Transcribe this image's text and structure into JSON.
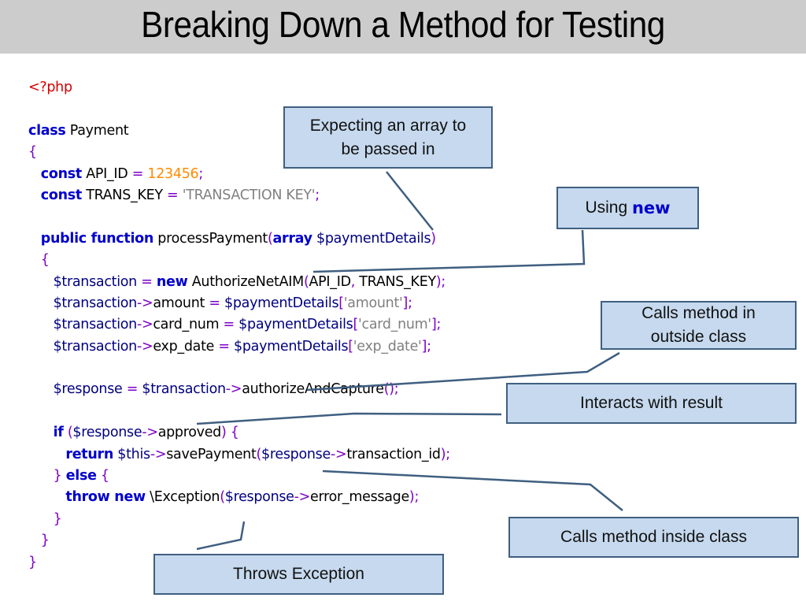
{
  "slide": {
    "title": "Breaking Down a Method for Testing"
  },
  "code": {
    "lines": [
      [
        {
          "t": "tag",
          "v": "<?php"
        }
      ],
      [],
      [
        {
          "t": "kw",
          "v": "class"
        },
        {
          "t": "ident",
          "v": " Payment"
        }
      ],
      [
        {
          "t": "op",
          "v": "{"
        }
      ],
      [
        {
          "t": "ident",
          "v": "   "
        },
        {
          "t": "kw",
          "v": "const"
        },
        {
          "t": "ident",
          "v": " API_ID "
        },
        {
          "t": "op",
          "v": "="
        },
        {
          "t": "ident",
          "v": " "
        },
        {
          "t": "num",
          "v": "123456"
        },
        {
          "t": "op",
          "v": ";"
        }
      ],
      [
        {
          "t": "ident",
          "v": "   "
        },
        {
          "t": "kw",
          "v": "const"
        },
        {
          "t": "ident",
          "v": " TRANS_KEY "
        },
        {
          "t": "op",
          "v": "="
        },
        {
          "t": "ident",
          "v": " "
        },
        {
          "t": "str",
          "v": "'TRANSACTION KEY'"
        },
        {
          "t": "op",
          "v": ";"
        }
      ],
      [],
      [
        {
          "t": "ident",
          "v": "   "
        },
        {
          "t": "kw",
          "v": "public function"
        },
        {
          "t": "ident",
          "v": " processPayment"
        },
        {
          "t": "op",
          "v": "("
        },
        {
          "t": "kw",
          "v": "array"
        },
        {
          "t": "var",
          "v": " $paymentDetails"
        },
        {
          "t": "op",
          "v": ")"
        }
      ],
      [
        {
          "t": "ident",
          "v": "   "
        },
        {
          "t": "op",
          "v": "{"
        }
      ],
      [
        {
          "t": "ident",
          "v": "      "
        },
        {
          "t": "var",
          "v": "$transaction"
        },
        {
          "t": "ident",
          "v": " "
        },
        {
          "t": "op",
          "v": "="
        },
        {
          "t": "ident",
          "v": " "
        },
        {
          "t": "kw",
          "v": "new"
        },
        {
          "t": "ident",
          "v": " AuthorizeNetAIM"
        },
        {
          "t": "op",
          "v": "("
        },
        {
          "t": "ident",
          "v": "API_ID"
        },
        {
          "t": "op",
          "v": ","
        },
        {
          "t": "ident",
          "v": " TRANS_KEY"
        },
        {
          "t": "op",
          "v": ");"
        }
      ],
      [
        {
          "t": "ident",
          "v": "      "
        },
        {
          "t": "var",
          "v": "$transaction"
        },
        {
          "t": "op",
          "v": "->"
        },
        {
          "t": "ident",
          "v": "amount "
        },
        {
          "t": "op",
          "v": "="
        },
        {
          "t": "var",
          "v": " $paymentDetails"
        },
        {
          "t": "op",
          "v": "["
        },
        {
          "t": "str",
          "v": "'amount'"
        },
        {
          "t": "op",
          "v": "];"
        }
      ],
      [
        {
          "t": "ident",
          "v": "      "
        },
        {
          "t": "var",
          "v": "$transaction"
        },
        {
          "t": "op",
          "v": "->"
        },
        {
          "t": "ident",
          "v": "card_num "
        },
        {
          "t": "op",
          "v": "="
        },
        {
          "t": "var",
          "v": " $paymentDetails"
        },
        {
          "t": "op",
          "v": "["
        },
        {
          "t": "str",
          "v": "'card_num'"
        },
        {
          "t": "op",
          "v": "];"
        }
      ],
      [
        {
          "t": "ident",
          "v": "      "
        },
        {
          "t": "var",
          "v": "$transaction"
        },
        {
          "t": "op",
          "v": "->"
        },
        {
          "t": "ident",
          "v": "exp_date "
        },
        {
          "t": "op",
          "v": "="
        },
        {
          "t": "var",
          "v": " $paymentDetails"
        },
        {
          "t": "op",
          "v": "["
        },
        {
          "t": "str",
          "v": "'exp_date'"
        },
        {
          "t": "op",
          "v": "];"
        }
      ],
      [],
      [
        {
          "t": "ident",
          "v": "      "
        },
        {
          "t": "var",
          "v": "$response"
        },
        {
          "t": "ident",
          "v": " "
        },
        {
          "t": "op",
          "v": "="
        },
        {
          "t": "var",
          "v": " $transaction"
        },
        {
          "t": "op",
          "v": "->"
        },
        {
          "t": "ident",
          "v": "authorizeAndCapture"
        },
        {
          "t": "op",
          "v": "();"
        }
      ],
      [],
      [
        {
          "t": "ident",
          "v": "      "
        },
        {
          "t": "kw",
          "v": "if"
        },
        {
          "t": "ident",
          "v": " "
        },
        {
          "t": "op",
          "v": "("
        },
        {
          "t": "var",
          "v": "$response"
        },
        {
          "t": "op",
          "v": "->"
        },
        {
          "t": "ident",
          "v": "approved"
        },
        {
          "t": "op",
          "v": ")"
        },
        {
          "t": "ident",
          "v": " "
        },
        {
          "t": "op",
          "v": "{"
        }
      ],
      [
        {
          "t": "ident",
          "v": "         "
        },
        {
          "t": "kw",
          "v": "return"
        },
        {
          "t": "var",
          "v": " $this"
        },
        {
          "t": "op",
          "v": "->"
        },
        {
          "t": "ident",
          "v": "savePayment"
        },
        {
          "t": "op",
          "v": "("
        },
        {
          "t": "var",
          "v": "$response"
        },
        {
          "t": "op",
          "v": "->"
        },
        {
          "t": "ident",
          "v": "transaction_id"
        },
        {
          "t": "op",
          "v": ");"
        }
      ],
      [
        {
          "t": "ident",
          "v": "      "
        },
        {
          "t": "op",
          "v": "}"
        },
        {
          "t": "ident",
          "v": " "
        },
        {
          "t": "kw",
          "v": "else"
        },
        {
          "t": "ident",
          "v": " "
        },
        {
          "t": "op",
          "v": "{"
        }
      ],
      [
        {
          "t": "ident",
          "v": "         "
        },
        {
          "t": "kw",
          "v": "throw new"
        },
        {
          "t": "ident",
          "v": " \\Exception"
        },
        {
          "t": "op",
          "v": "("
        },
        {
          "t": "var",
          "v": "$response"
        },
        {
          "t": "op",
          "v": "->"
        },
        {
          "t": "ident",
          "v": "error_message"
        },
        {
          "t": "op",
          "v": ");"
        }
      ],
      [
        {
          "t": "ident",
          "v": "      "
        },
        {
          "t": "op",
          "v": "}"
        }
      ],
      [
        {
          "t": "ident",
          "v": "   "
        },
        {
          "t": "op",
          "v": "}"
        }
      ],
      [
        {
          "t": "op",
          "v": "}"
        }
      ]
    ]
  },
  "callouts": {
    "array": {
      "line1": "Expecting an array to",
      "line2": "be passed in"
    },
    "new": {
      "prefix": "Using ",
      "keyword": "new"
    },
    "outside": {
      "line1": "Calls method in",
      "line2": "outside class"
    },
    "result": {
      "text": "Interacts with result"
    },
    "inside": {
      "text": "Calls method inside class"
    },
    "exception": {
      "text": "Throws Exception"
    }
  },
  "colors": {
    "keyword": "#0000cc",
    "variable": "#000080",
    "operator": "#7d00c8",
    "number": "#ff8c00",
    "string": "#808080",
    "php_tag": "#d40000",
    "callout_fill": "#c6d9ee",
    "callout_border": "#3f5f80",
    "title_bar": "#cccccc"
  }
}
